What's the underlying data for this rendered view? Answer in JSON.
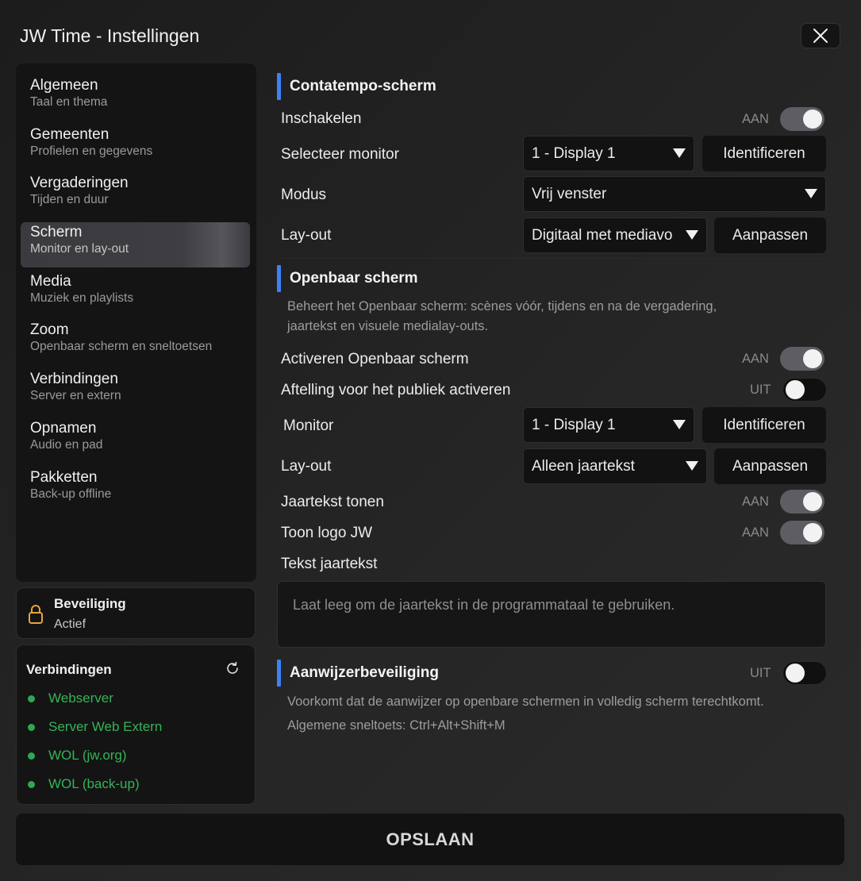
{
  "window": {
    "title": "JW Time - Instellingen"
  },
  "sidebar": {
    "items": [
      {
        "label": "Algemeen",
        "sub": "Taal en thema"
      },
      {
        "label": "Gemeenten",
        "sub": "Profielen en gegevens"
      },
      {
        "label": "Vergaderingen",
        "sub": "Tijden en duur"
      },
      {
        "label": "Scherm",
        "sub": "Monitor en lay-out"
      },
      {
        "label": "Media",
        "sub": "Muziek en playlists"
      },
      {
        "label": "Zoom",
        "sub": "Openbaar scherm en sneltoetsen"
      },
      {
        "label": "Verbindingen",
        "sub": "Server en extern"
      },
      {
        "label": "Opnamen",
        "sub": "Audio en pad"
      },
      {
        "label": "Pakketten",
        "sub": "Back-up offline"
      }
    ],
    "active_index": 3
  },
  "security": {
    "title": "Beveiliging",
    "status": "Actief"
  },
  "connections": {
    "title": "Verbindingen",
    "items": [
      {
        "label": "Webserver"
      },
      {
        "label": "Server Web Extern"
      },
      {
        "label": "WOL (jw.org)"
      },
      {
        "label": "WOL (back-up)"
      }
    ],
    "status_color": "#34b356"
  },
  "contatempo": {
    "heading": "Contatempo-scherm",
    "enable_label": "Inschakelen",
    "enable_state": "AAN",
    "monitor_label": "Selecteer monitor",
    "monitor_value": "1 - Display 1",
    "identify_label": "Identificeren",
    "mode_label": "Modus",
    "mode_value": "Vrij venster",
    "layout_label": "Lay-out",
    "layout_value": "Digitaal met mediavo",
    "customize_label": "Aanpassen"
  },
  "public_screen": {
    "heading": "Openbaar scherm",
    "description_line1": "Beheert het Openbaar scherm: scènes vóór, tijdens en na de vergadering,",
    "description_line2": "jaartekst en visuele medialay-outs.",
    "activate_label": "Activeren Openbaar scherm",
    "activate_state": "AAN",
    "countdown_label": "Aftelling voor het publiek activeren",
    "countdown_state": "UIT",
    "monitor_label": "Monitor",
    "monitor_value": "1 - Display 1",
    "identify_label": "Identificeren",
    "layout_label": "Lay-out",
    "layout_value": "Alleen jaartekst",
    "customize_label": "Aanpassen",
    "yeartext_label": "Jaartekst tonen",
    "yeartext_state": "AAN",
    "logo_label": "Toon logo JW",
    "logo_state": "AAN",
    "yeartext_text_label": "Tekst jaartekst",
    "yeartext_placeholder": "Laat leeg om de jaartekst in de programmataal te gebruiken."
  },
  "pointer": {
    "heading": "Aanwijzerbeveiliging",
    "state": "UIT",
    "description": "Voorkomt dat de aanwijzer op openbare schermen in volledig scherm terechtkomt.",
    "shortcut": "Algemene sneltoets: Ctrl+Alt+Shift+M"
  },
  "footer": {
    "save_label": "OPSLAAN"
  },
  "colors": {
    "accent": "#3b82f6",
    "success": "#34b356"
  }
}
